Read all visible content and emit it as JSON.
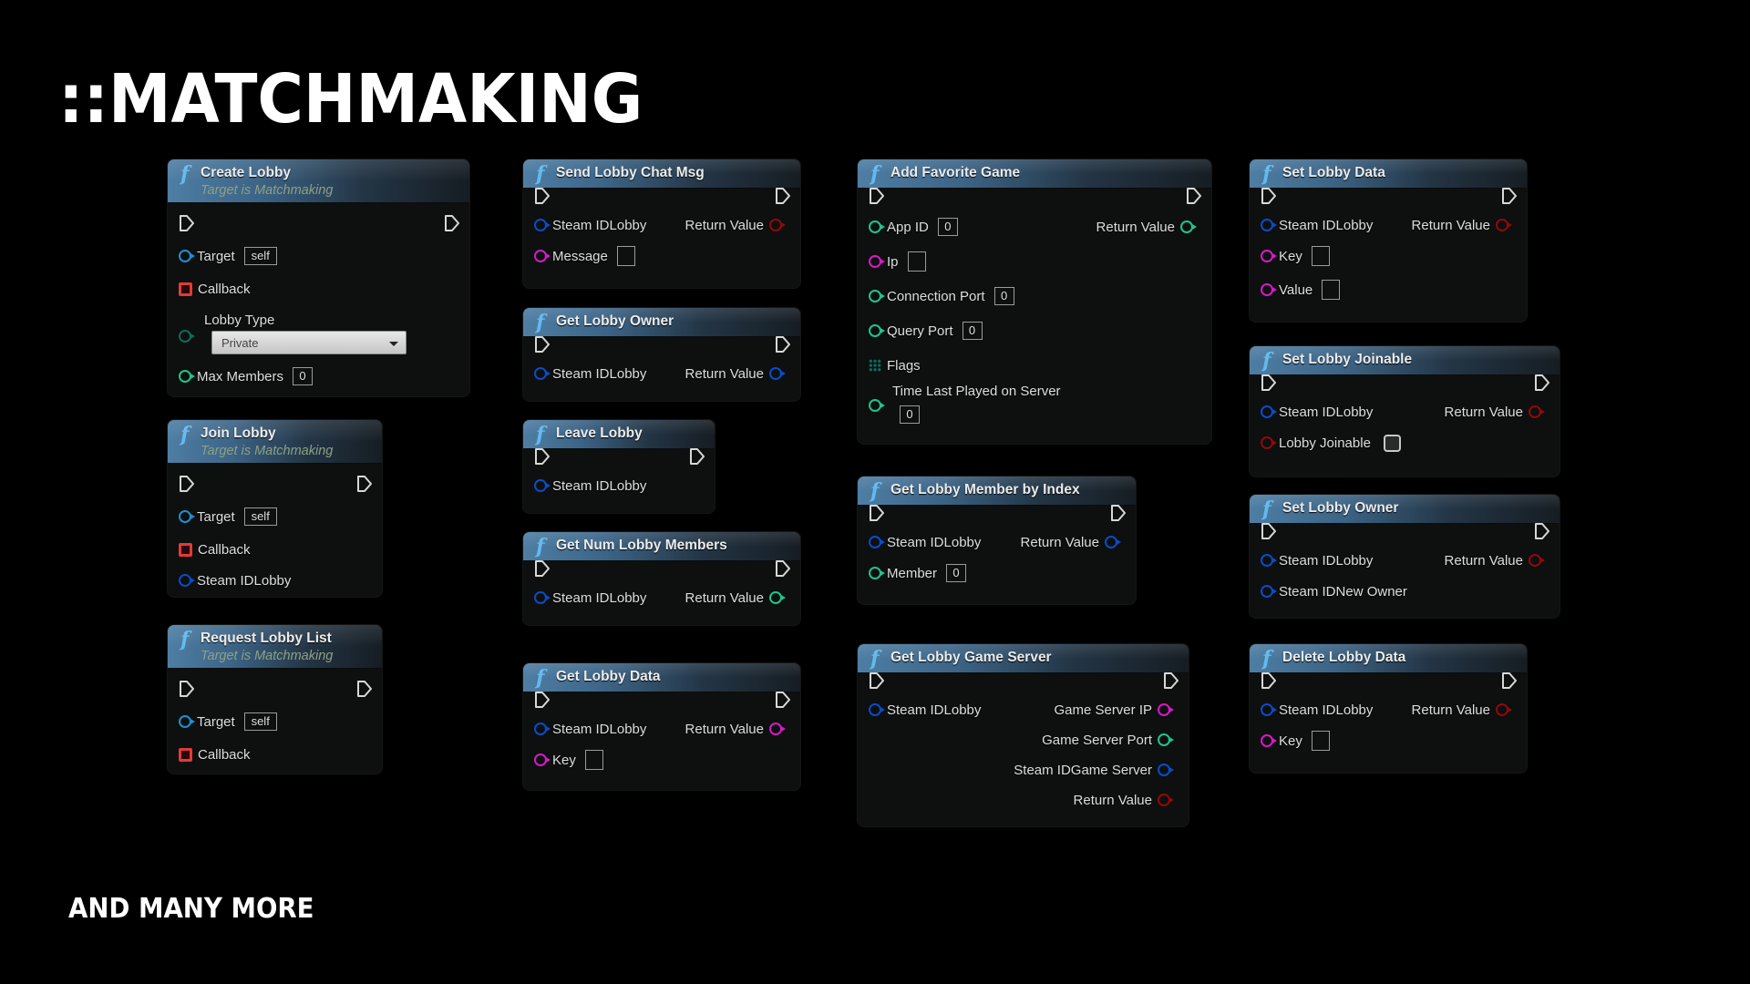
{
  "page": {
    "title": "::MATCHMAKING",
    "footer": "AND MANY MORE"
  },
  "colors": {
    "exec": "#d8d8d8",
    "object_ref": "#1f8fd0",
    "steam_id": "#0a4cc8",
    "delegate": "#e23a3a",
    "byte_enum": "#0d6b5a",
    "int": "#1fc48e",
    "string": "#d41ac8",
    "bool": "#8e0a0a",
    "flags": "#0f6b62"
  },
  "nodes": [
    {
      "id": "create-lobby",
      "title": "Create Lobby",
      "subtitle": "Target is Matchmaking",
      "exec_in": true,
      "exec_out": true,
      "inputs": [
        {
          "label": "Target",
          "type": "object_ref",
          "value": "self"
        },
        {
          "label": "Callback",
          "type": "delegate"
        },
        {
          "label": "Lobby Type",
          "type": "byte_enum",
          "dropdown": "Private"
        },
        {
          "label": "Max Members",
          "type": "int",
          "value": "0"
        }
      ],
      "outputs": []
    },
    {
      "id": "join-lobby",
      "title": "Join Lobby",
      "subtitle": "Target is Matchmaking",
      "exec_in": true,
      "exec_out": true,
      "inputs": [
        {
          "label": "Target",
          "type": "object_ref",
          "value": "self"
        },
        {
          "label": "Callback",
          "type": "delegate"
        },
        {
          "label": "Steam IDLobby",
          "type": "steam_id"
        }
      ],
      "outputs": []
    },
    {
      "id": "request-lobby-list",
      "title": "Request Lobby List",
      "subtitle": "Target is Matchmaking",
      "exec_in": true,
      "exec_out": true,
      "inputs": [
        {
          "label": "Target",
          "type": "object_ref",
          "value": "self"
        },
        {
          "label": "Callback",
          "type": "delegate"
        }
      ],
      "outputs": []
    },
    {
      "id": "send-lobby-chat-msg",
      "title": "Send Lobby Chat Msg",
      "exec_in": true,
      "exec_out": true,
      "inputs": [
        {
          "label": "Steam IDLobby",
          "type": "steam_id"
        },
        {
          "label": "Message",
          "type": "string",
          "value": ""
        }
      ],
      "outputs": [
        {
          "label": "Return Value",
          "type": "bool"
        }
      ]
    },
    {
      "id": "get-lobby-owner",
      "title": "Get Lobby Owner",
      "exec_in": true,
      "exec_out": true,
      "inputs": [
        {
          "label": "Steam IDLobby",
          "type": "steam_id"
        }
      ],
      "outputs": [
        {
          "label": "Return Value",
          "type": "steam_id"
        }
      ]
    },
    {
      "id": "leave-lobby",
      "title": "Leave Lobby",
      "exec_in": true,
      "exec_out": true,
      "inputs": [
        {
          "label": "Steam IDLobby",
          "type": "steam_id"
        }
      ],
      "outputs": []
    },
    {
      "id": "get-num-lobby-members",
      "title": "Get Num Lobby Members",
      "exec_in": true,
      "exec_out": true,
      "inputs": [
        {
          "label": "Steam IDLobby",
          "type": "steam_id"
        }
      ],
      "outputs": [
        {
          "label": "Return Value",
          "type": "int"
        }
      ]
    },
    {
      "id": "get-lobby-data",
      "title": "Get Lobby Data",
      "exec_in": true,
      "exec_out": true,
      "inputs": [
        {
          "label": "Steam IDLobby",
          "type": "steam_id"
        },
        {
          "label": "Key",
          "type": "string",
          "value": ""
        }
      ],
      "outputs": [
        {
          "label": "Return Value",
          "type": "string"
        }
      ]
    },
    {
      "id": "add-favorite-game",
      "title": "Add Favorite Game",
      "exec_in": true,
      "exec_out": true,
      "inputs": [
        {
          "label": "App ID",
          "type": "int",
          "value": "0"
        },
        {
          "label": "Ip",
          "type": "string",
          "value": ""
        },
        {
          "label": "Connection Port",
          "type": "int",
          "value": "0"
        },
        {
          "label": "Query Port",
          "type": "int",
          "value": "0"
        },
        {
          "label": "Flags",
          "type": "flags"
        },
        {
          "label": "Time Last Played on Server",
          "type": "int",
          "value": "0",
          "value_below": true
        }
      ],
      "outputs": [
        {
          "label": "Return Value",
          "type": "int"
        }
      ]
    },
    {
      "id": "get-lobby-member-by-index",
      "title": "Get Lobby Member by Index",
      "exec_in": true,
      "exec_out": true,
      "inputs": [
        {
          "label": "Steam IDLobby",
          "type": "steam_id"
        },
        {
          "label": "Member",
          "type": "int",
          "value": "0"
        }
      ],
      "outputs": [
        {
          "label": "Return Value",
          "type": "steam_id"
        }
      ]
    },
    {
      "id": "get-lobby-game-server",
      "title": "Get Lobby Game Server",
      "exec_in": true,
      "exec_out": true,
      "inputs": [
        {
          "label": "Steam IDLobby",
          "type": "steam_id"
        }
      ],
      "outputs": [
        {
          "label": "Game Server IP",
          "type": "string"
        },
        {
          "label": "Game Server Port",
          "type": "int"
        },
        {
          "label": "Steam IDGame Server",
          "type": "steam_id"
        },
        {
          "label": "Return Value",
          "type": "bool"
        }
      ]
    },
    {
      "id": "set-lobby-data",
      "title": "Set Lobby Data",
      "exec_in": true,
      "exec_out": true,
      "inputs": [
        {
          "label": "Steam IDLobby",
          "type": "steam_id"
        },
        {
          "label": "Key",
          "type": "string",
          "value": ""
        },
        {
          "label": "Value",
          "type": "string",
          "value": ""
        }
      ],
      "outputs": [
        {
          "label": "Return Value",
          "type": "bool"
        }
      ]
    },
    {
      "id": "set-lobby-joinable",
      "title": "Set Lobby Joinable",
      "exec_in": true,
      "exec_out": true,
      "inputs": [
        {
          "label": "Steam IDLobby",
          "type": "steam_id"
        },
        {
          "label": "Lobby Joinable",
          "type": "bool",
          "checkbox": false
        }
      ],
      "outputs": [
        {
          "label": "Return Value",
          "type": "bool"
        }
      ]
    },
    {
      "id": "set-lobby-owner",
      "title": "Set Lobby Owner",
      "exec_in": true,
      "exec_out": true,
      "inputs": [
        {
          "label": "Steam IDLobby",
          "type": "steam_id"
        },
        {
          "label": "Steam IDNew Owner",
          "type": "steam_id"
        }
      ],
      "outputs": [
        {
          "label": "Return Value",
          "type": "bool"
        }
      ]
    },
    {
      "id": "delete-lobby-data",
      "title": "Delete Lobby Data",
      "exec_in": true,
      "exec_out": true,
      "inputs": [
        {
          "label": "Steam IDLobby",
          "type": "steam_id"
        },
        {
          "label": "Key",
          "type": "string",
          "value": ""
        }
      ],
      "outputs": [
        {
          "label": "Return Value",
          "type": "bool"
        }
      ]
    }
  ]
}
